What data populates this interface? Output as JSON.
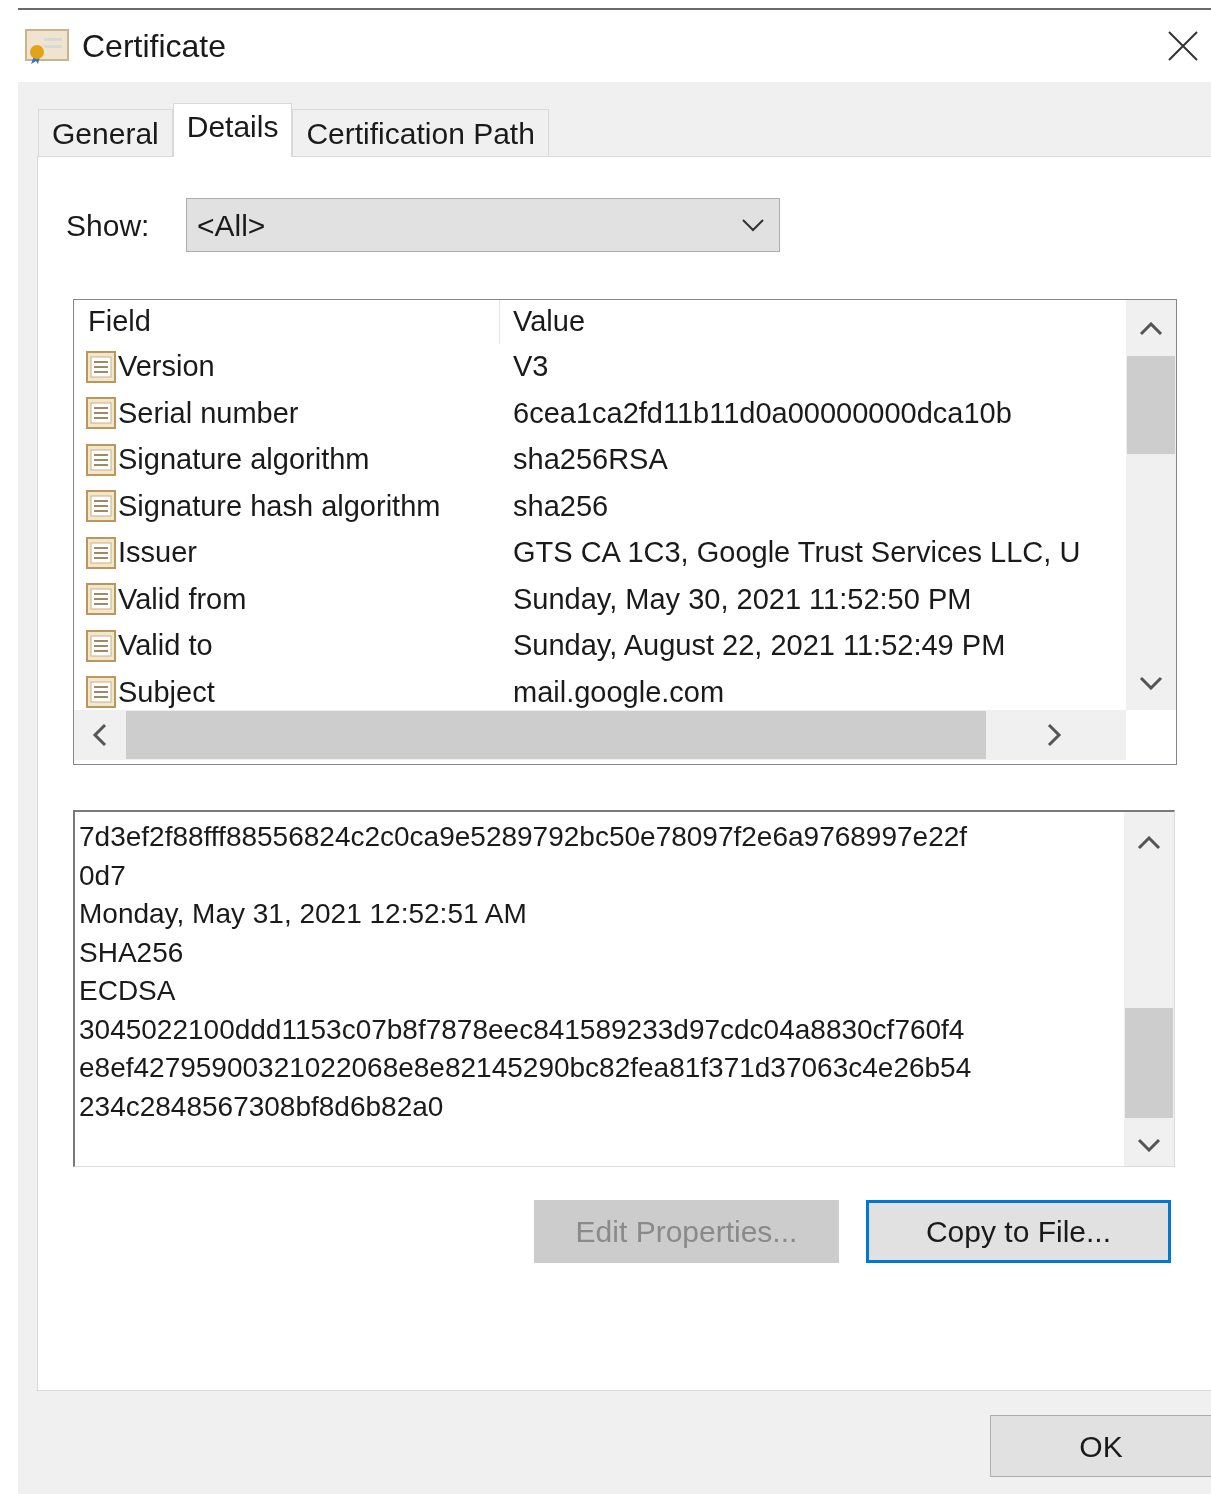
{
  "window": {
    "title": "Certificate"
  },
  "tabs": [
    {
      "label": "General",
      "selected": false
    },
    {
      "label": "Details",
      "selected": true
    },
    {
      "label": "Certification Path",
      "selected": false
    }
  ],
  "show": {
    "label": "Show:",
    "value": "<All>"
  },
  "table": {
    "columns": [
      "Field",
      "Value"
    ],
    "rows": [
      {
        "field": "Version",
        "value": "V3"
      },
      {
        "field": "Serial number",
        "value": "6cea1ca2fd11b11d0a00000000dca10b"
      },
      {
        "field": "Signature algorithm",
        "value": "sha256RSA"
      },
      {
        "field": "Signature hash algorithm",
        "value": "sha256"
      },
      {
        "field": "Issuer",
        "value": "GTS CA 1C3, Google Trust Services LLC, U"
      },
      {
        "field": "Valid from",
        "value": "Sunday, May 30, 2021 11:52:50 PM"
      },
      {
        "field": "Valid to",
        "value": "Sunday, August 22, 2021 11:52:49 PM"
      },
      {
        "field": "Subject",
        "value": "mail.google.com"
      }
    ]
  },
  "detail_lines": [
    "7d3ef2f88fff88556824c2c0ca9e5289792bc50e78097f2e6a9768997e22f",
    "0d7",
    "Monday, May 31, 2021 12:52:51 AM",
    "SHA256",
    "ECDSA",
    "3045022100ddd1153c07b8f7878eec841589233d97cdc04a8830cf760f4",
    "e8ef42795900321022068e8e82145290bc82fea81f371d37063c4e26b54",
    "234c2848567308bf8d6b82a0"
  ],
  "buttons": [
    {
      "label": "Edit Properties...",
      "disabled": true,
      "focused": false
    },
    {
      "label": "Copy to File...",
      "disabled": false,
      "focused": true
    }
  ],
  "ok_button": {
    "label": "OK"
  }
}
